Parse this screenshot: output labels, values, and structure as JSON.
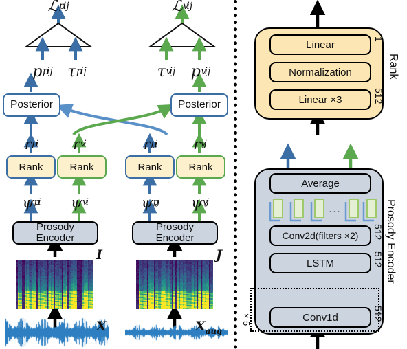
{
  "figure": {
    "type": "neural-network-architecture-diagram",
    "panels": [
      "training-objective-branch",
      "module-details"
    ]
  },
  "colors": {
    "blue": "#3b6ea5",
    "green": "#5ba84f",
    "rank_fill": "#fdf0cd",
    "panel_rank_fill": "#fbe6b4",
    "encoder_fill": "#ccd4e0",
    "black": "#000000",
    "waveform": "#2d7fc1"
  },
  "left": {
    "losses": [
      {
        "name": "loss-p",
        "base": "ℒ",
        "sup": "p",
        "sub": "ij",
        "arrow_color": "#3b6ea5"
      },
      {
        "name": "loss-v",
        "base": "ℒ",
        "sup": "v",
        "sub": "ij",
        "arrow_color": "#5ba84f"
      }
    ],
    "probabilities": [
      {
        "base": "p",
        "sup": "p",
        "sub": "ij",
        "arrow_color": "#3b6ea5"
      },
      {
        "base": "τ",
        "sup": "p",
        "sub": "ij",
        "arrow_color": "#3b6ea5"
      },
      {
        "base": "τ",
        "sup": "v",
        "sub": "ij",
        "arrow_color": "#5ba84f"
      },
      {
        "base": "p",
        "sup": "v",
        "sub": "ij",
        "arrow_color": "#5ba84f"
      }
    ],
    "posterior_label": "Posterior",
    "posteriors": [
      {
        "name": "posterior-left",
        "label": "Posterior"
      },
      {
        "name": "posterior-right",
        "label": "Posterior"
      }
    ],
    "representations": [
      {
        "base": "r",
        "sup": "p",
        "sub": "i",
        "arrow_color": "#3b6ea5"
      },
      {
        "base": "r",
        "sup": "v",
        "sub": "i",
        "arrow_color": "#5ba84f"
      },
      {
        "base": "r",
        "sup": "p",
        "sub": "j",
        "arrow_color": "#3b6ea5"
      },
      {
        "base": "r",
        "sup": "v",
        "sub": "j",
        "arrow_color": "#5ba84f"
      }
    ],
    "rank_label": "Rank",
    "ranks": [
      {
        "name": "rank-i-p",
        "label": "Rank",
        "border": "#3b6ea5"
      },
      {
        "name": "rank-i-v",
        "label": "Rank",
        "border": "#5ba84f"
      },
      {
        "name": "rank-j-p",
        "label": "Rank",
        "border": "#3b6ea5"
      },
      {
        "name": "rank-j-v",
        "label": "Rank",
        "border": "#5ba84f"
      }
    ],
    "psis": [
      {
        "base": "ψ",
        "sup": "p",
        "sub": "i",
        "arrow_color": "#3b6ea5"
      },
      {
        "base": "ψ",
        "sup": "v",
        "sub": "i",
        "arrow_color": "#5ba84f"
      },
      {
        "base": "ψ",
        "sup": "p",
        "sub": "j",
        "arrow_color": "#3b6ea5"
      },
      {
        "base": "ψ",
        "sup": "v",
        "sub": "j",
        "arrow_color": "#5ba84f"
      }
    ],
    "encoder_label_line1": "Prosody",
    "encoder_label_line2": "Encoder",
    "encoders": [
      {
        "name": "prosody-encoder-left",
        "line1": "Prosody",
        "line2": "Encoder"
      },
      {
        "name": "prosody-encoder-right",
        "line1": "Prosody",
        "line2": "Encoder"
      }
    ],
    "spectrogram_labels": [
      {
        "name": "spectrogram-label-I",
        "text": "I"
      },
      {
        "name": "spectrogram-label-J",
        "text": "J"
      }
    ],
    "waveform_labels": [
      {
        "name": "waveform-label-X",
        "base": "X",
        "sub": ""
      },
      {
        "name": "waveform-label-X-aug",
        "base": "X",
        "sub": "aug"
      }
    ]
  },
  "right": {
    "rank_module": {
      "title": "Rank",
      "layers": [
        {
          "label": "Linear",
          "dim": "1"
        },
        {
          "label": "Normalization",
          "dim": ""
        },
        {
          "label": "Linear ×3",
          "dim": "512"
        }
      ]
    },
    "prosody_encoder_module": {
      "title": "Prosody Encoder",
      "average_label": "Average",
      "frames_ellipsis": "···",
      "layers": [
        {
          "label": "Conv2d(filters ×2)",
          "dim": "512"
        },
        {
          "label": "LSTM",
          "dim": "512"
        },
        {
          "label": "Conv1d",
          "dim": "512"
        }
      ],
      "repeat_label": "×5",
      "residual_add": "+"
    }
  }
}
